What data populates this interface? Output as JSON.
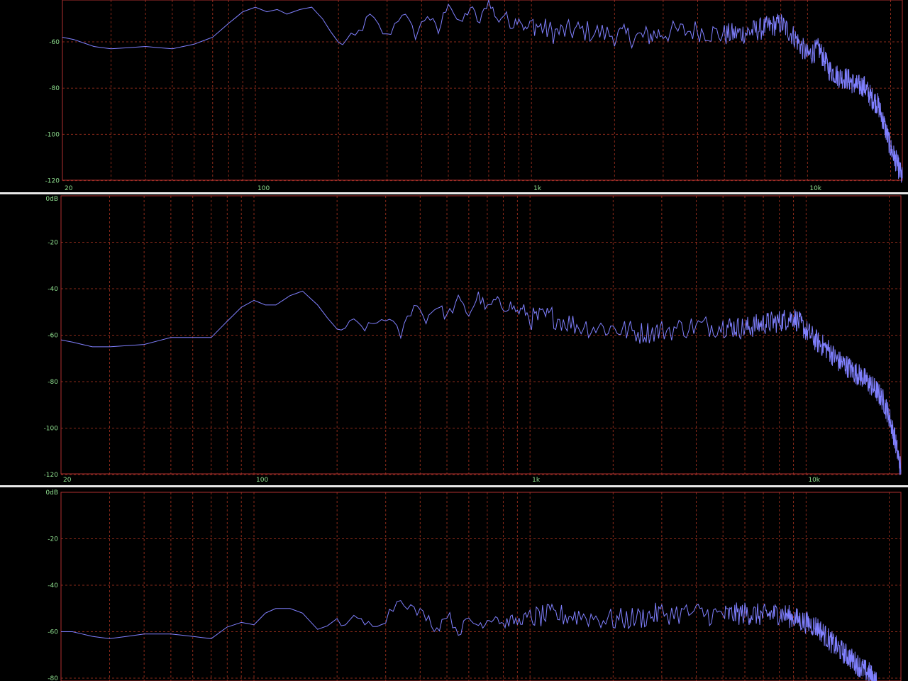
{
  "colors": {
    "background": "#000000",
    "plot_border": "#b03030",
    "grid": "#8a2a1a",
    "tick_label": "#8fe08f",
    "trace": "#8080ff",
    "separator": "#e8e8e8"
  },
  "chart_data": [
    {
      "type": "line",
      "x_scale": "log",
      "xlim": [
        20,
        22050
      ],
      "ylim": [
        -120,
        0
      ],
      "visible_ylim": [
        -120,
        -42
      ],
      "grid": true,
      "x_tick_labels": [
        {
          "value": 20,
          "label": "20"
        },
        {
          "value": 100,
          "label": "100"
        },
        {
          "value": 1000,
          "label": "1k"
        },
        {
          "value": 10000,
          "label": "10k"
        }
      ],
      "y_tick_labels": [
        {
          "value": -60,
          "label": "-60"
        },
        {
          "value": -80,
          "label": "-80"
        },
        {
          "value": -100,
          "label": "-100"
        },
        {
          "value": -120,
          "label": "-120"
        }
      ],
      "series": [
        {
          "x": [
            20,
            22,
            26,
            30,
            40,
            50,
            60,
            70,
            80,
            90,
            100,
            110,
            120,
            130,
            145,
            160,
            175,
            200,
            230,
            260,
            300,
            340,
            380,
            420,
            460,
            500,
            550,
            600,
            650,
            700,
            750,
            800,
            850,
            900,
            950,
            1000,
            1200,
            1500,
            2000,
            2500,
            3000,
            4000,
            5000,
            6000,
            7000,
            8000,
            9000,
            10000,
            11000,
            12000,
            13000,
            14000,
            15000,
            16000,
            17000,
            18000,
            19000,
            20000,
            21000,
            22050
          ],
          "y": [
            -58,
            -59,
            -62,
            -63,
            -62,
            -63,
            -61,
            -58,
            -52,
            -47,
            -45,
            -47,
            -46,
            -48,
            -46,
            -45,
            -50,
            -61,
            -58,
            -49,
            -58,
            -47,
            -57,
            -48,
            -56,
            -42,
            -53,
            -45,
            -52,
            -41,
            -51,
            -48,
            -53,
            -49,
            -55,
            -52,
            -56,
            -55,
            -57,
            -58,
            -56,
            -55,
            -57,
            -56,
            -54,
            -52,
            -58,
            -66,
            -63,
            -72,
            -75,
            -76,
            -79,
            -79,
            -84,
            -87,
            -96,
            -106,
            -112,
            -119
          ]
        }
      ]
    },
    {
      "type": "line",
      "x_scale": "log",
      "xlim": [
        20,
        22050
      ],
      "ylim": [
        -120,
        0
      ],
      "grid": true,
      "x_tick_labels": [
        {
          "value": 20,
          "label": "20"
        },
        {
          "value": 100,
          "label": "100"
        },
        {
          "value": 1000,
          "label": "1k"
        },
        {
          "value": 10000,
          "label": "10k"
        }
      ],
      "y_tick_labels": [
        {
          "value": 0,
          "label": "0dB"
        },
        {
          "value": -20,
          "label": "-20"
        },
        {
          "value": -40,
          "label": "-40"
        },
        {
          "value": -60,
          "label": "-60"
        },
        {
          "value": -80,
          "label": "-80"
        },
        {
          "value": -100,
          "label": "-100"
        },
        {
          "value": -120,
          "label": "-120"
        }
      ],
      "series": [
        {
          "x": [
            20,
            22,
            26,
            30,
            40,
            50,
            60,
            70,
            80,
            90,
            100,
            110,
            120,
            135,
            150,
            170,
            200,
            230,
            260,
            300,
            340,
            380,
            420,
            460,
            500,
            550,
            600,
            650,
            700,
            750,
            800,
            850,
            900,
            950,
            1000,
            1200,
            1500,
            2000,
            2500,
            3000,
            4000,
            5000,
            6000,
            7000,
            8000,
            9000,
            10000,
            11000,
            12000,
            13000,
            14000,
            15000,
            16000,
            17000,
            18000,
            19000,
            20000,
            21000,
            22050
          ],
          "y": [
            -62,
            -63,
            -65,
            -65,
            -64,
            -61,
            -61,
            -61,
            -54,
            -48,
            -45,
            -47,
            -47,
            -43,
            -41,
            -47,
            -58,
            -55,
            -57,
            -52,
            -60,
            -46,
            -53,
            -47,
            -52,
            -45,
            -51,
            -43,
            -49,
            -45,
            -48,
            -47,
            -50,
            -49,
            -53,
            -52,
            -56,
            -57,
            -59,
            -58,
            -56,
            -56,
            -57,
            -55,
            -54,
            -52,
            -58,
            -63,
            -66,
            -71,
            -73,
            -76,
            -78,
            -81,
            -84,
            -88,
            -95,
            -105,
            -118
          ]
        }
      ]
    },
    {
      "type": "line",
      "x_scale": "log",
      "xlim": [
        20,
        22050
      ],
      "ylim": [
        -120,
        0
      ],
      "visible_ylim": [
        -80,
        0
      ],
      "grid": true,
      "x_tick_labels": [],
      "y_tick_labels": [
        {
          "value": 0,
          "label": "0dB"
        },
        {
          "value": -20,
          "label": "-20"
        },
        {
          "value": -40,
          "label": "-40"
        },
        {
          "value": -60,
          "label": "-60"
        },
        {
          "value": -80,
          "label": "-80"
        }
      ],
      "series": [
        {
          "x": [
            20,
            22,
            26,
            30,
            40,
            50,
            60,
            70,
            80,
            90,
            100,
            110,
            120,
            135,
            150,
            170,
            200,
            230,
            260,
            300,
            340,
            380,
            420,
            460,
            500,
            550,
            600,
            650,
            700,
            750,
            800,
            850,
            900,
            950,
            1000,
            1200,
            1500,
            2000,
            2500,
            3000,
            4000,
            5000,
            6000,
            7000,
            8000,
            9000,
            10000,
            11000,
            12000,
            13000,
            14000,
            15000,
            16000,
            17000,
            18000
          ],
          "y": [
            -60,
            -60,
            -62,
            -63,
            -61,
            -61,
            -62,
            -63,
            -58,
            -56,
            -57,
            -52,
            -50,
            -50,
            -52,
            -59,
            -56,
            -55,
            -57,
            -54,
            -45,
            -51,
            -53,
            -59,
            -52,
            -60,
            -55,
            -57,
            -55,
            -53,
            -57,
            -55,
            -56,
            -54,
            -54,
            -53,
            -53,
            -55,
            -54,
            -52,
            -52,
            -53,
            -52,
            -53,
            -52,
            -54,
            -56,
            -58,
            -63,
            -67,
            -70,
            -73,
            -76,
            -78,
            -82
          ]
        }
      ]
    }
  ]
}
